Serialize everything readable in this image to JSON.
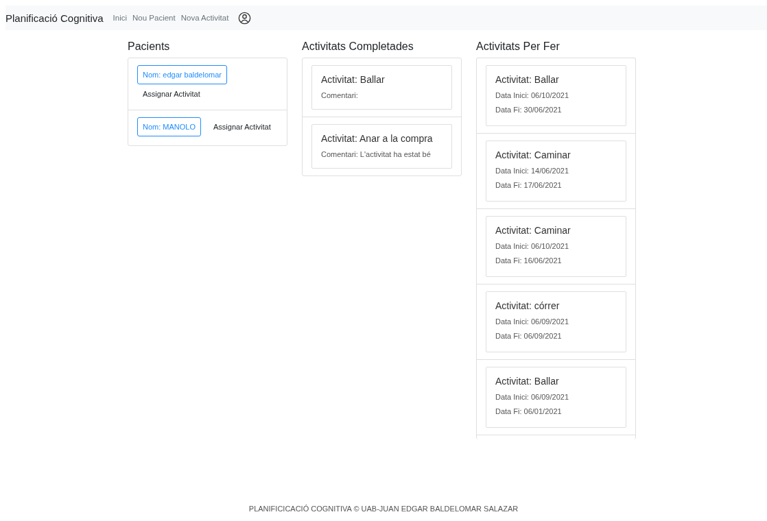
{
  "navbar": {
    "brand": "Planificació Cognitiva",
    "links": [
      {
        "label": "Inici"
      },
      {
        "label": "Nou Pacient"
      },
      {
        "label": "Nova Activitat"
      }
    ]
  },
  "patients": {
    "title": "Pacients",
    "items": [
      {
        "name": "Nom: edgar baldelomar",
        "action": "Assignar Activitat"
      },
      {
        "name": "Nom: MANOLO",
        "action": "Assignar Activitat"
      }
    ]
  },
  "completed": {
    "title": "Activitats Completades",
    "items": [
      {
        "title": "Activitat: Ballar",
        "lines": [
          "Comentari:"
        ]
      },
      {
        "title": "Activitat: Anar a la compra",
        "lines": [
          "Comentari: L'activitat ha estat bé"
        ]
      }
    ]
  },
  "todo": {
    "title": "Activitats Per Fer",
    "items": [
      {
        "title": "Activitat: Ballar",
        "lines": [
          "Data Inici: 06/10/2021",
          "Data Fi: 30/06/2021"
        ]
      },
      {
        "title": "Activitat: Caminar",
        "lines": [
          "Data Inici: 14/06/2021",
          "Data Fi: 17/06/2021"
        ]
      },
      {
        "title": "Activitat: Caminar",
        "lines": [
          "Data Inici: 06/10/2021",
          "Data Fi: 16/06/2021"
        ]
      },
      {
        "title": "Activitat: córrer",
        "lines": [
          "Data Inici: 06/09/2021",
          "Data Fi: 06/09/2021"
        ]
      },
      {
        "title": "Activitat: Ballar",
        "lines": [
          "Data Inici: 06/09/2021",
          "Data Fi: 06/01/2021"
        ]
      }
    ]
  },
  "footer": "PLANIFICICACIÓ COGNITIVA © UAB-JUAN EDGAR BALDELOMAR SALAZAR"
}
